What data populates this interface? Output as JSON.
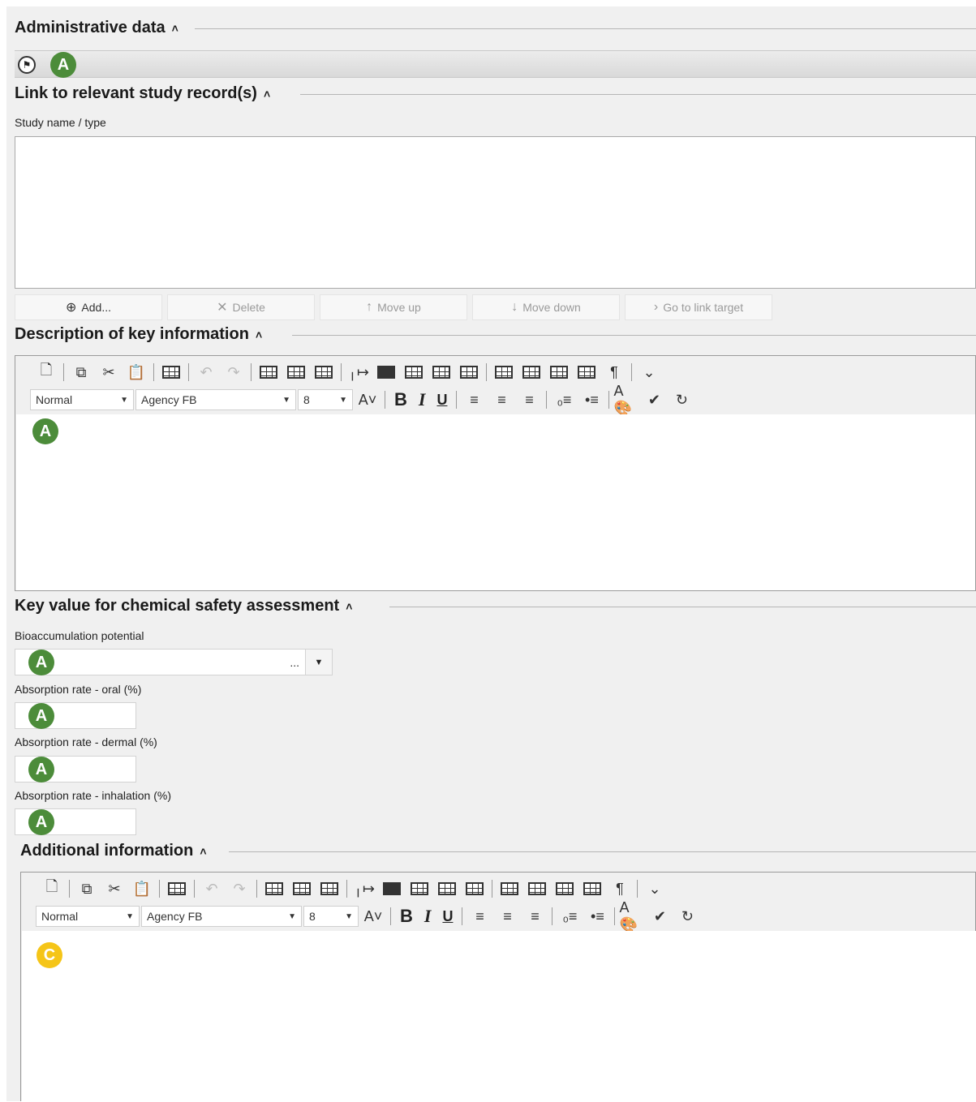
{
  "admin": {
    "title": "Administrative data",
    "badge": "A"
  },
  "link": {
    "title": "Link to relevant study record(s)",
    "field_label": "Study name / type",
    "buttons": {
      "add": "Add...",
      "delete": "Delete",
      "move_up": "Move up",
      "move_down": "Move down",
      "go_to": "Go to link target"
    }
  },
  "description": {
    "title": "Description of key information",
    "toolbar": {
      "style": "Normal",
      "font": "Agency FB",
      "size": "8"
    },
    "badge": "A"
  },
  "key_value": {
    "title": "Key value for chemical safety assessment",
    "bioaccumulation_label": "Bioaccumulation potential",
    "bioaccumulation_value": "...",
    "oral_label": "Absorption rate - oral (%)",
    "dermal_label": "Absorption rate - dermal (%)",
    "inhalation_label": "Absorption rate - inhalation (%)",
    "badge": "A"
  },
  "additional": {
    "title": "Additional information",
    "toolbar": {
      "style": "Normal",
      "font": "Agency FB",
      "size": "8"
    },
    "badge": "C"
  },
  "colors": {
    "badge_green": "#4c8c3a",
    "badge_yellow": "#f5c518",
    "panel": "#f0f0f0"
  }
}
